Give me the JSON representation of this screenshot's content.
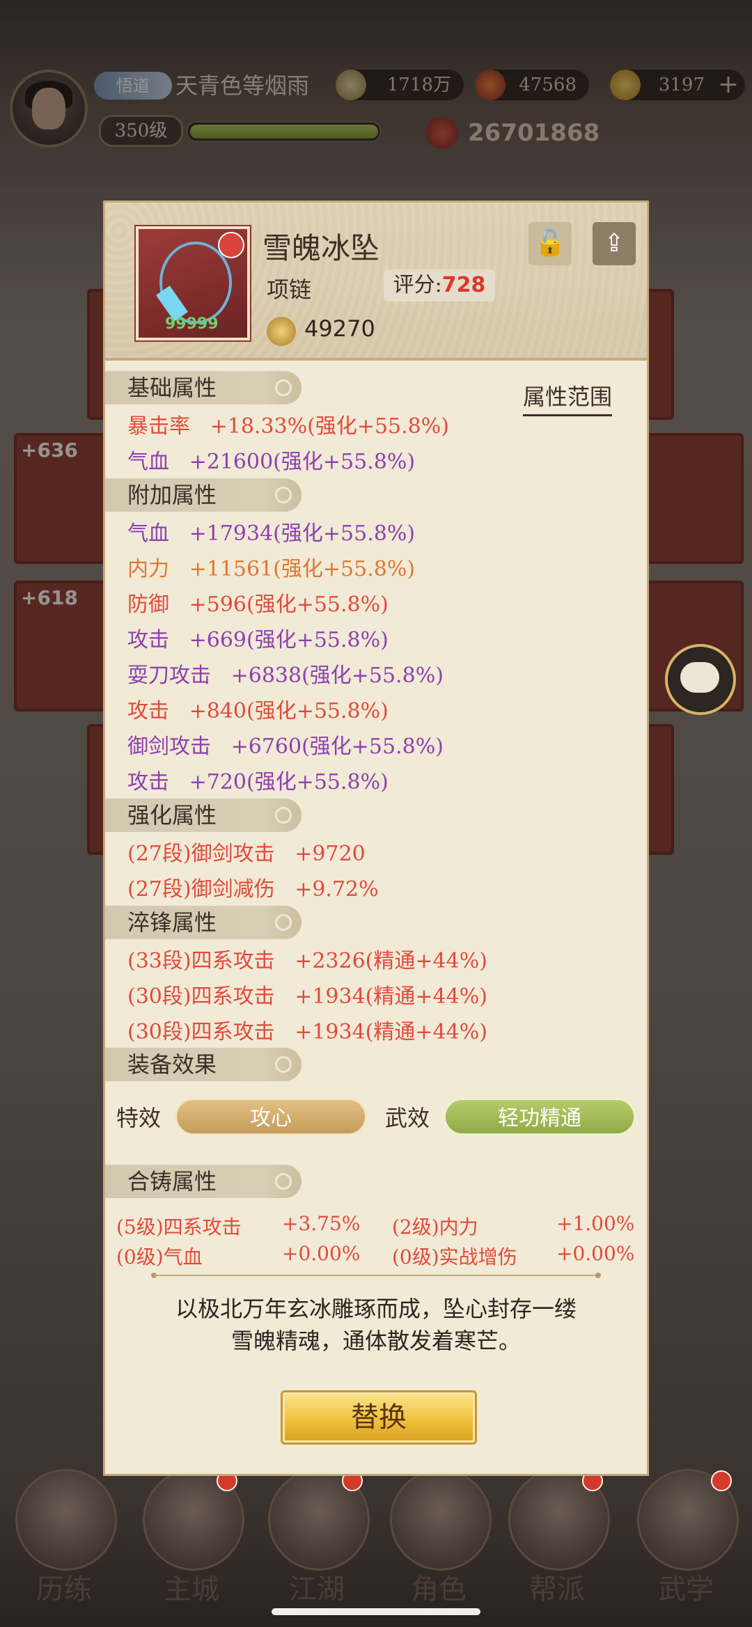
{
  "header": {
    "tag": "悟道",
    "player_name": "天青色等烟雨",
    "silver": "1718万",
    "gems": "47568",
    "gold": "3197",
    "level": "350级",
    "exp_fraction": 0.98,
    "power": "26701868"
  },
  "side_slots": [
    "+636",
    "+618"
  ],
  "item": {
    "name": "雪魄冰坠",
    "type": "项链",
    "score_label": "评分:",
    "score": "728",
    "coin_value": "49270",
    "icon_text": "99999"
  },
  "sections": {
    "base": "基础属性",
    "extra": "附加属性",
    "enhance": "强化属性",
    "temper": "淬锋属性",
    "effect": "装备效果",
    "cast": "合铸属性"
  },
  "range_link": "属性范围",
  "base_attrs": [
    "暴击率   +18.33%(强化+55.8%)",
    "气血   +21600(强化+55.8%)"
  ],
  "extra_attrs": [
    "气血   +17934(强化+55.8%)",
    "内力   +11561(强化+55.8%)",
    "防御   +596(强化+55.8%)",
    "攻击   +669(强化+55.8%)",
    "耍刀攻击   +6838(强化+55.8%)",
    "攻击   +840(强化+55.8%)",
    "御剑攻击   +6760(强化+55.8%)",
    "攻击   +720(强化+55.8%)"
  ],
  "enhance_attrs": [
    "(27段)御剑攻击   +9720",
    "(27段)御剑减伤   +9.72%"
  ],
  "temper_attrs": [
    "(33段)四系攻击   +2326(精通+44%)",
    "(30段)四系攻击   +1934(精通+44%)",
    "(30段)四系攻击   +1934(精通+44%)"
  ],
  "effects": {
    "special_label": "特效",
    "special_value": "攻心",
    "martial_label": "武效",
    "martial_value": "轻功精通"
  },
  "cast_attrs": [
    {
      "name": "(5级)四系攻击",
      "value": "+3.75%"
    },
    {
      "name": "(2级)内力",
      "value": "+1.00%"
    },
    {
      "name": "(0级)气血",
      "value": "+0.00%"
    },
    {
      "name": "(0级)实战增伤",
      "value": "+0.00%"
    }
  ],
  "description": [
    "以极北万年玄冰雕琢而成，坠心封存一缕",
    "雪魄精魂，通体散发着寒芒。"
  ],
  "replace_button": "替换",
  "nav": [
    "历练",
    "主城",
    "江湖",
    "角色",
    "帮派",
    "武学"
  ],
  "colors": {
    "red": "#e24a3c",
    "purple": "#8e3fb0",
    "orange": "#e07630"
  }
}
